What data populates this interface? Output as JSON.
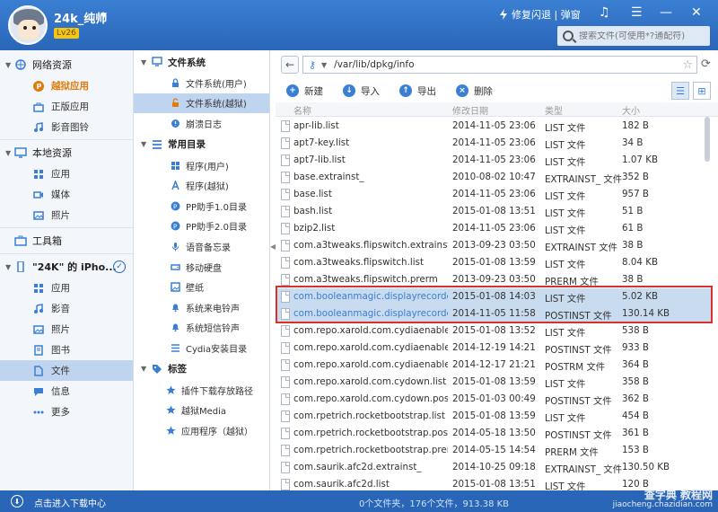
{
  "header": {
    "username": "24k_纯帅",
    "level": "Lv26",
    "fix_label": "修复闪退 | 弹窗",
    "search_placeholder": "搜索文件(可使用*?通配符)"
  },
  "left_sidebar": {
    "groups": [
      {
        "label": "网络资源",
        "items": [
          {
            "label": "越狱应用",
            "state": "highlight"
          },
          {
            "label": "正版应用"
          },
          {
            "label": "影音图铃"
          }
        ]
      },
      {
        "label": "本地资源",
        "items": [
          {
            "label": "应用"
          },
          {
            "label": "媒体"
          },
          {
            "label": "照片"
          }
        ]
      },
      {
        "label": "工具箱",
        "items": []
      },
      {
        "label": "\"24K\" 的 iPho...",
        "items": [
          {
            "label": "应用"
          },
          {
            "label": "影音"
          },
          {
            "label": "照片"
          },
          {
            "label": "图书"
          },
          {
            "label": "文件",
            "state": "active"
          },
          {
            "label": "信息"
          },
          {
            "label": "更多"
          }
        ]
      }
    ]
  },
  "middle_tree": {
    "file_system": {
      "label": "文件系统",
      "items": [
        "文件系统(用户)",
        "文件系统(越狱)",
        "崩溃日志"
      ]
    },
    "common_dirs": {
      "label": "常用目录",
      "items": [
        "程序(用户)",
        "程序(越狱)",
        "PP助手1.0目录",
        "PP助手2.0目录",
        "语音备忘录",
        "移动硬盘",
        "壁纸",
        "系统来电铃声",
        "系统短信铃声",
        "Cydia安装目录"
      ]
    },
    "tags": {
      "label": "标签",
      "items": [
        "插件下载存放路径",
        "越狱Media",
        "应用程序（越狱）"
      ]
    }
  },
  "path_bar": {
    "path": "/var/lib/dpkg/info"
  },
  "toolbar": {
    "new": "新建",
    "import": "导入",
    "export": "导出",
    "delete": "删除"
  },
  "table": {
    "columns": {
      "name": "名称",
      "date": "修改日期",
      "type": "类型",
      "size": "大小"
    },
    "rows": [
      {
        "name": "apr-lib.list",
        "date": "2014-11-05 23:06",
        "type": "LIST 文件",
        "size": "182 B"
      },
      {
        "name": "apt7-key.list",
        "date": "2014-11-05 23:06",
        "type": "LIST 文件",
        "size": "34 B"
      },
      {
        "name": "apt7-lib.list",
        "date": "2014-11-05 23:06",
        "type": "LIST 文件",
        "size": "1.07 KB"
      },
      {
        "name": "base.extrainst_",
        "date": "2010-08-02 10:47",
        "type": "EXTRAINST_ 文件",
        "size": "352 B"
      },
      {
        "name": "base.list",
        "date": "2014-11-05 23:06",
        "type": "LIST 文件",
        "size": "957 B"
      },
      {
        "name": "bash.list",
        "date": "2015-01-08 13:51",
        "type": "LIST 文件",
        "size": "51 B"
      },
      {
        "name": "bzip2.list",
        "date": "2014-11-05 23:06",
        "type": "LIST 文件",
        "size": "61 B"
      },
      {
        "name": "com.a3tweaks.flipswitch.extrainst",
        "date": "2013-09-23 03:50",
        "type": "EXTRAINST 文件",
        "size": "38 B"
      },
      {
        "name": "com.a3tweaks.flipswitch.list",
        "date": "2015-01-08 13:59",
        "type": "LIST 文件",
        "size": "8.04 KB"
      },
      {
        "name": "com.a3tweaks.flipswitch.prerm",
        "date": "2013-09-23 03:50",
        "type": "PRERM 文件",
        "size": "38 B"
      },
      {
        "name": "com.booleanmagic.displayrecorder...",
        "date": "2015-01-08 14:03",
        "type": "LIST 文件",
        "size": "5.02 KB",
        "selected": true
      },
      {
        "name": "com.booleanmagic.displayrecorder...",
        "date": "2014-11-05 11:58",
        "type": "POSTINST 文件",
        "size": "130.14 KB",
        "selected": true
      },
      {
        "name": "com.repo.xarold.com.cydiaenable.list",
        "date": "2015-01-08 13:52",
        "type": "LIST 文件",
        "size": "538 B"
      },
      {
        "name": "com.repo.xarold.com.cydiaenable.p...",
        "date": "2014-12-19 14:21",
        "type": "POSTINST 文件",
        "size": "933 B"
      },
      {
        "name": "com.repo.xarold.com.cydiaenable.p...",
        "date": "2014-12-17 21:21",
        "type": "POSTRM 文件",
        "size": "364 B"
      },
      {
        "name": "com.repo.xarold.com.cydown.list",
        "date": "2015-01-08 13:59",
        "type": "LIST 文件",
        "size": "358 B"
      },
      {
        "name": "com.repo.xarold.com.cydown.posti...",
        "date": "2015-01-03 00:49",
        "type": "POSTINST 文件",
        "size": "362 B"
      },
      {
        "name": "com.rpetrich.rocketbootstrap.list",
        "date": "2015-01-08 13:59",
        "type": "LIST 文件",
        "size": "454 B"
      },
      {
        "name": "com.rpetrich.rocketbootstrap.posti...",
        "date": "2014-05-18 13:50",
        "type": "POSTINST 文件",
        "size": "361 B"
      },
      {
        "name": "com.rpetrich.rocketbootstrap.prerm",
        "date": "2014-05-15 14:54",
        "type": "PRERM 文件",
        "size": "153 B"
      },
      {
        "name": "com.saurik.afc2d.extrainst_",
        "date": "2014-10-25 09:18",
        "type": "EXTRAINST_ 文件",
        "size": "130.50 KB"
      },
      {
        "name": "com.saurik.afc2d.list",
        "date": "2015-01-08 13:51",
        "type": "LIST 文件",
        "size": "120 B"
      }
    ]
  },
  "footer": {
    "download_center": "点击进入下载中心",
    "status": "0个文件夹，176个文件，913.38 KB",
    "watermark_top": "查字典 教程网",
    "watermark_bottom": "jiaocheng.chazidian.com"
  },
  "colors": {
    "brand": "#2a66b8",
    "highlight": "#e07c10",
    "selection": "#c9dbef",
    "annotation": "#d9302c"
  }
}
